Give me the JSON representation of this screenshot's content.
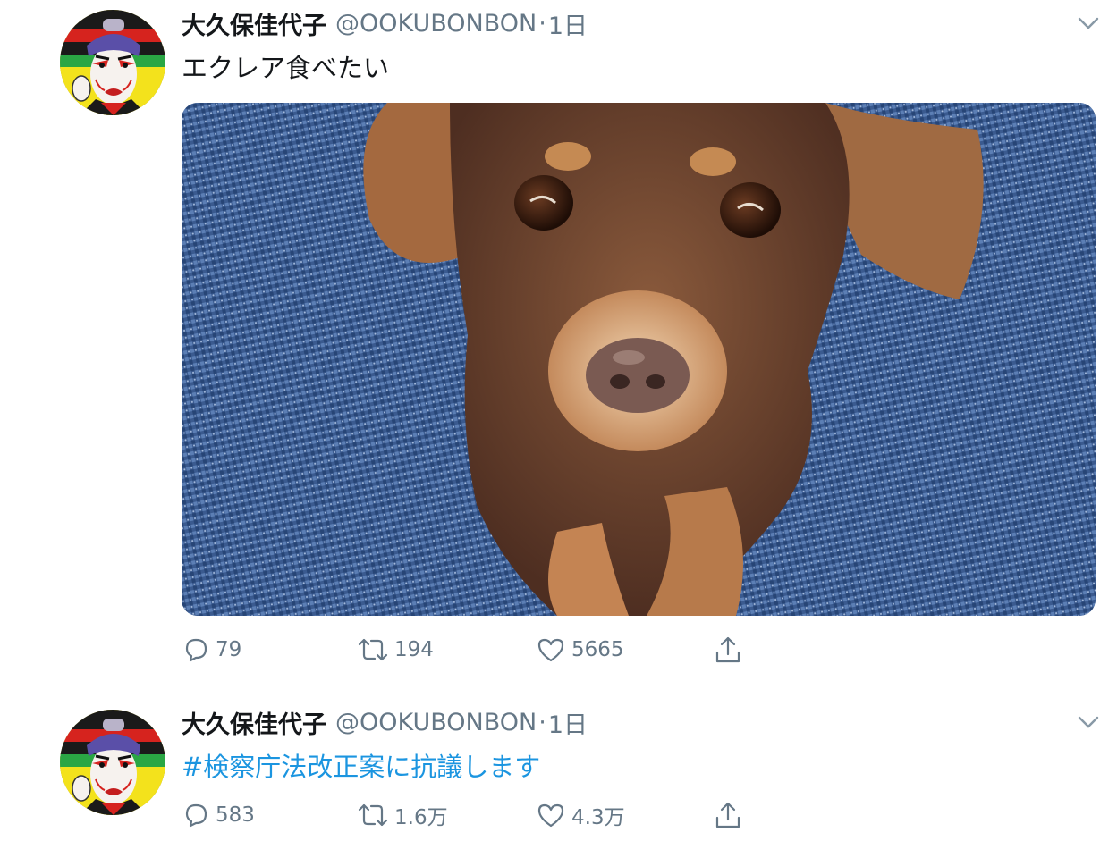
{
  "tweets": [
    {
      "name": "大久保佳代子",
      "handle": "@OOKUBONBON",
      "separator": "·",
      "time": "1日",
      "text": "エクレア食べたい",
      "has_media": true,
      "media_alt": "dog-photo",
      "actions": {
        "replies": "79",
        "retweets": "194",
        "likes": "5665"
      }
    },
    {
      "name": "大久保佳代子",
      "handle": "@OOKUBONBON",
      "separator": "·",
      "time": "1日",
      "text": "#検察庁法改正案に抗議します",
      "has_media": false,
      "actions": {
        "replies": "583",
        "retweets": "1.6万",
        "likes": "4.3万"
      }
    }
  ],
  "colors": {
    "link": "#1b95e0",
    "secondary": "#657786",
    "divider": "#e1e8ed"
  },
  "icons": [
    "reply-icon",
    "retweet-icon",
    "like-icon",
    "share-icon",
    "chevron-down-icon"
  ]
}
